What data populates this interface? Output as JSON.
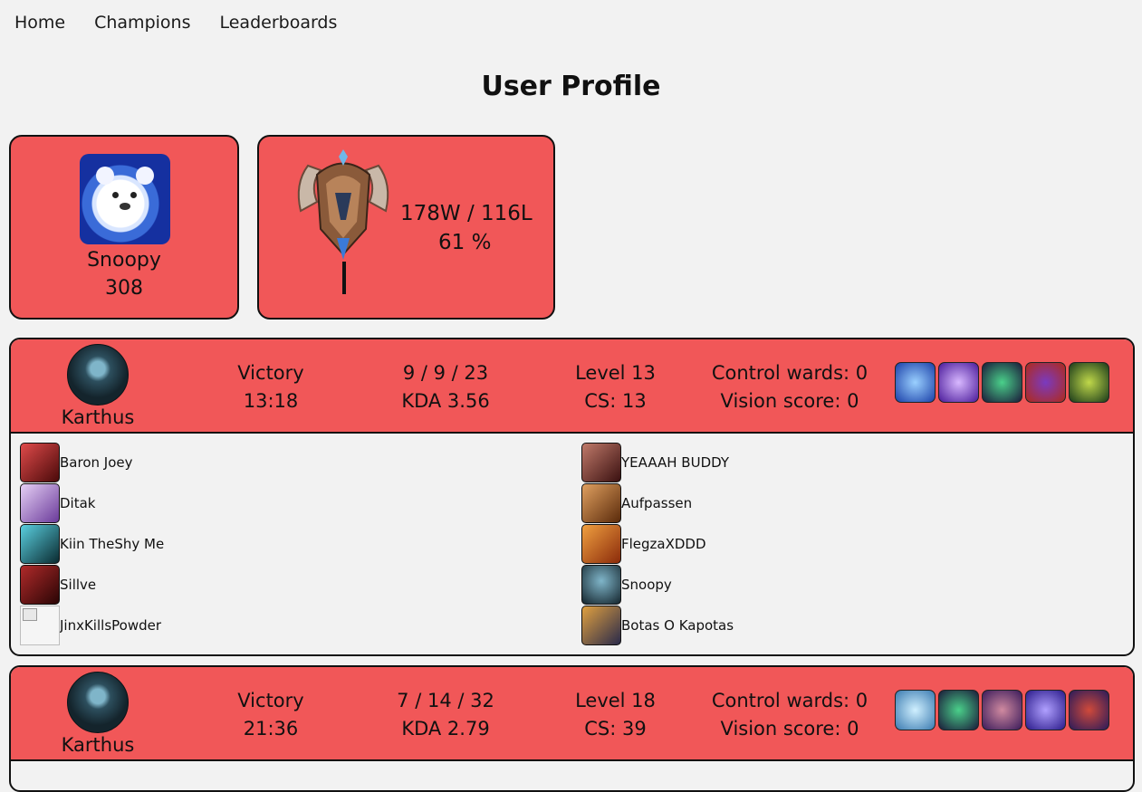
{
  "nav": {
    "home": "Home",
    "champions": "Champions",
    "leaderboards": "Leaderboards"
  },
  "page_title": "User Profile",
  "profile": {
    "name": "Snoopy",
    "level": "308"
  },
  "rank": {
    "record": "178W / 116L",
    "winrate": "61 %"
  },
  "matches": [
    {
      "champion": "Karthus",
      "result": "Victory",
      "duration": "13:18",
      "kills_deaths_assists": "9 / 9 / 23",
      "kda": "KDA 3.56",
      "level": "Level 13",
      "cs": "CS: 13",
      "control_wards": "Control wards: 0",
      "vision_score": "Vision score: 0",
      "items": [
        "#2a5fd0",
        "#7a3fc0",
        "#2c4a3a",
        "#b03030",
        "#3a6a2a"
      ],
      "team_left": [
        {
          "name": "Baron Joey",
          "color": "#a32222"
        },
        {
          "name": "Ditak",
          "color": "#b58fd9"
        },
        {
          "name": "Kiin TheShy Me",
          "color": "#1e5a66"
        },
        {
          "name": "Sillve",
          "color": "#6a1010"
        },
        {
          "name": "JinxKillsPowder",
          "color": ""
        }
      ],
      "team_right": [
        {
          "name": "YEAAAH BUDDY",
          "color": "#6a2a2a"
        },
        {
          "name": "Aufpassen",
          "color": "#8a5a2a"
        },
        {
          "name": "FlegzaXDDD",
          "color": "#c0561e"
        },
        {
          "name": "Snoopy",
          "color": "#2d4f5e"
        },
        {
          "name": "Botas O Kapotas",
          "color": "#3a3a4a"
        }
      ]
    },
    {
      "champion": "Karthus",
      "result": "Victory",
      "duration": "21:36",
      "kills_deaths_assists": "7 / 14 / 32",
      "kda": "KDA 2.79",
      "level": "Level 18",
      "cs": "CS: 39",
      "control_wards": "Control wards: 0",
      "vision_score": "Vision score: 0",
      "items": [
        "#4aa0c8",
        "#2c4a3a",
        "#6a3aa0",
        "#5a3ad0",
        "#8a2a3a"
      ]
    }
  ]
}
